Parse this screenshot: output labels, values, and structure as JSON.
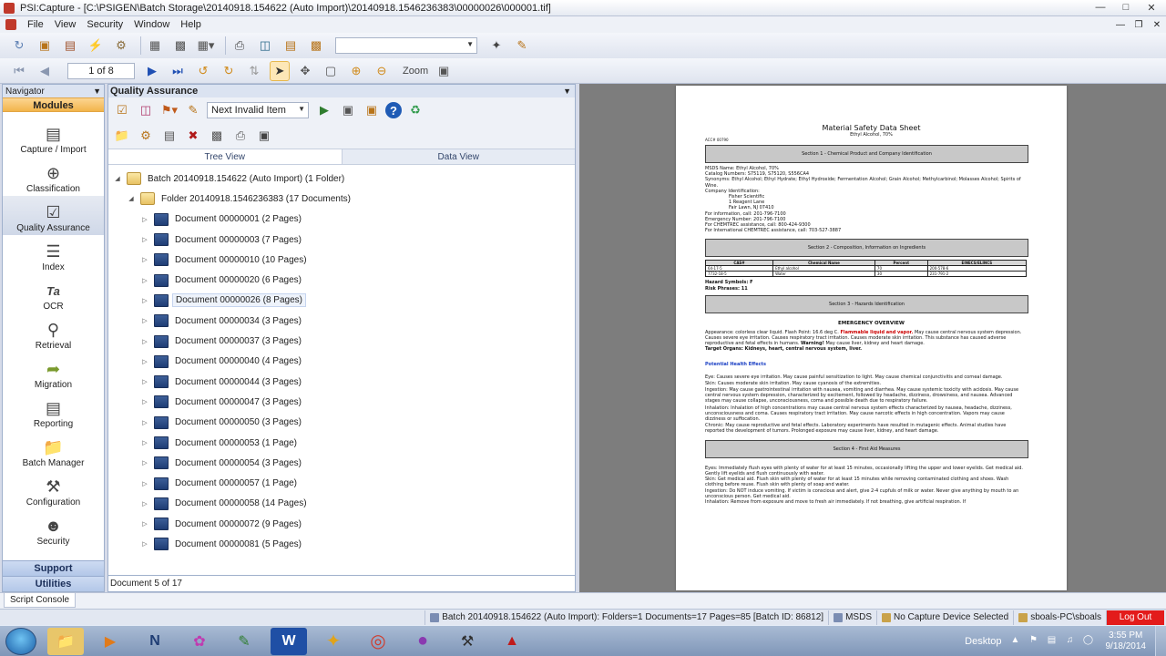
{
  "window": {
    "title": "PSI:Capture - [C:\\PSIGEN\\Batch Storage\\20140918.154622 (Auto Import)\\20140918.1546236383\\00000026\\000001.tif]"
  },
  "menu": [
    "File",
    "View",
    "Security",
    "Window",
    "Help"
  ],
  "toolbar": {
    "page_indicator": "1 of 8",
    "zoom_label": "Zoom"
  },
  "navigator": {
    "title": "Navigator",
    "section": "Modules",
    "items": [
      {
        "label": "Capture / Import",
        "icon": "scanner-icon"
      },
      {
        "label": "Classification",
        "icon": "crosshair-icon"
      },
      {
        "label": "Quality Assurance",
        "icon": "checklist-icon"
      },
      {
        "label": "Index",
        "icon": "index-list-icon"
      },
      {
        "label": "OCR",
        "icon": "ocr-icon"
      },
      {
        "label": "Retrieval",
        "icon": "magnifier-icon"
      },
      {
        "label": "Migration",
        "icon": "migration-icon"
      },
      {
        "label": "Reporting",
        "icon": "report-icon"
      },
      {
        "label": "Batch Manager",
        "icon": "folder-icon"
      },
      {
        "label": "Configuration",
        "icon": "wrench-icon"
      },
      {
        "label": "Security",
        "icon": "user-lock-icon"
      }
    ],
    "bottom_sections": [
      "Support",
      "Utilities"
    ]
  },
  "qa": {
    "title": "Quality Assurance",
    "next_invalid": "Next Invalid Item",
    "tabs": [
      "Tree View",
      "Data View"
    ],
    "batch_label": "Batch 20140918.154622 (Auto Import) (1 Folder)",
    "folder_label": "Folder 20140918.1546236383 (17 Documents)",
    "documents": [
      "Document 00000001 (2 Pages)",
      "Document 00000003 (7 Pages)",
      "Document 00000010 (10 Pages)",
      "Document 00000020 (6 Pages)",
      "Document 00000026 (8 Pages)",
      "Document 00000034 (3 Pages)",
      "Document 00000037 (3 Pages)",
      "Document 00000040 (4 Pages)",
      "Document 00000044 (3 Pages)",
      "Document 00000047 (3 Pages)",
      "Document 00000050 (3 Pages)",
      "Document 00000053 (1 Page)",
      "Document 00000054 (3 Pages)",
      "Document 00000057 (1 Page)",
      "Document 00000058 (14 Pages)",
      "Document 00000072 (9 Pages)",
      "Document 00000081 (5 Pages)"
    ],
    "selected_index": 4,
    "status": "Document 5 of 17"
  },
  "document_page": {
    "title": "Material Safety Data Sheet",
    "subtitle": "Ethyl Alcohol, 70%",
    "acc": "ACC# 00790",
    "section1": "Section 1 - Chemical Product and Company Identification",
    "s1_lines": [
      "MSDS Name: Ethyl Alcohol, 70%",
      "Catalog Numbers: S75119, S75120, S556CA4",
      "Synonyms: Ethyl Alcohol; Ethyl Hydrate; Ethyl Hydroxide; Fermentation Alcohol; Grain Alcohol; Methylcarbinol; Molasses Alcohol; Spirits of Wine.",
      "Company Identification:",
      "Fisher Scientific",
      "1 Reagent Lane",
      "Fair Lawn, NJ 07410",
      "For information, call: 201-796-7100",
      "Emergency Number: 201-796-7100",
      "For CHEMTREC assistance, call: 800-424-9300",
      "For International CHEMTREC assistance, call: 703-527-3887"
    ],
    "section2": "Section 2 - Composition, Information on Ingredients",
    "table_headers": [
      "CAS#",
      "Chemical Name",
      "Percent",
      "EINECS/ELINCS"
    ],
    "table_rows": [
      [
        "64-17-5",
        "Ethyl alcohol",
        "70",
        "200-578-6"
      ],
      [
        "7732-18-5",
        "Water",
        "30",
        "231-791-2"
      ]
    ],
    "hazard_lines": [
      "Hazard Symbols: F",
      "Risk Phrases: 11"
    ],
    "section3": "Section 3 - Hazards Identification",
    "emergency_overview": "EMERGENCY OVERVIEW",
    "appearance": "Appearance: colorless clear liquid. Flash Point: 16.6 deg C.",
    "flammable": "Flammable liquid and vapor.",
    "s3_text": "May cause central nervous system depression. Causes severe eye irritation. Causes respiratory tract irritation. Causes moderate skin irritation. This substance has caused adverse reproductive and fetal effects in humans.",
    "warning": "Warning!",
    "warning_text": "May cause liver, kidney and heart damage.",
    "target_organs": "Target Organs: Kidneys, heart, central nervous system, liver.",
    "potential_health": "Potential Health Effects",
    "health_lines": [
      "Eye: Causes severe eye irritation. May cause painful sensitization to light. May cause chemical conjunctivitis and corneal damage.",
      "Skin: Causes moderate skin irritation. May cause cyanosis of the extremities.",
      "Ingestion: May cause gastrointestinal irritation with nausea, vomiting and diarrhea. May cause systemic toxicity with acidosis. May cause central nervous system depression, characterized by excitement, followed by headache, dizziness, drowsiness, and nausea. Advanced stages may cause collapse, unconsciousness, coma and possible death due to respiratory failure.",
      "Inhalation: Inhalation of high concentrations may cause central nervous system effects characterized by nausea, headache, dizziness, unconsciousness and coma. Causes respiratory tract irritation. May cause narcotic effects in high concentration. Vapors may cause dizziness or suffocation.",
      "Chronic: May cause reproductive and fetal effects. Laboratory experiments have resulted in mutagenic effects. Animal studies have reported the development of tumors. Prolonged exposure may cause liver, kidney, and heart damage."
    ],
    "section4": "Section 4 - First Aid Measures",
    "aid_lines": [
      "Eyes: Immediately flush eyes with plenty of water for at least 15 minutes, occasionally lifting the upper and lower eyelids. Get medical aid. Gently lift eyelids and flush continuously with water.",
      "Skin: Get medical aid. Flush skin with plenty of water for at least 15 minutes while removing contaminated clothing and shoes. Wash clothing before reuse. Flush skin with plenty of soap and water.",
      "Ingestion: Do NOT induce vomiting. If victim is conscious and alert, give 2-4 cupfuls of milk or water. Never give anything by mouth to an unconscious person. Get medical aid.",
      "Inhalation: Remove from exposure and move to fresh air immediately. If not breathing, give artificial respiration. If"
    ]
  },
  "script_console": "Script Console",
  "statusbar": {
    "batch_info": "Batch 20140918.154622 (Auto Import): Folders=1 Documents=17 Pages=85 [Batch ID: 86812]",
    "doc_type": "MSDS",
    "capture_device": "No Capture Device Selected",
    "user": "sboals-PC\\sboals",
    "logout": "Log Out"
  },
  "taskbar": {
    "desktop_label": "Desktop",
    "time": "3:55 PM",
    "date": "9/18/2014"
  },
  "colors": {
    "modules_header": "#f2b44b",
    "logout": "#e31b1b",
    "doc_icon": "#1f3d74"
  }
}
